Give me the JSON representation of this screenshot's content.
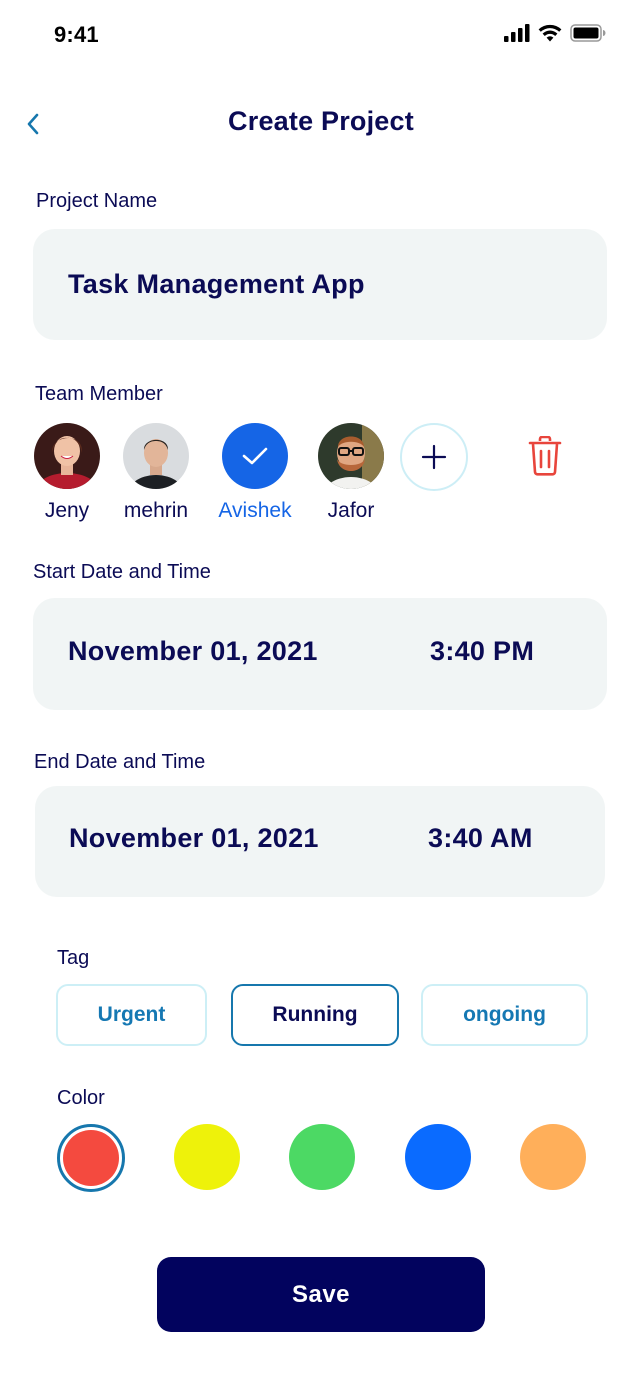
{
  "status_bar": {
    "time": "9:41"
  },
  "header": {
    "title": "Create Project"
  },
  "project_name": {
    "label": "Project Name",
    "value": "Task Management App"
  },
  "team": {
    "label": "Team Member",
    "members": [
      {
        "name": "Jeny",
        "selected": false
      },
      {
        "name": "mehrin",
        "selected": false
      },
      {
        "name": "Avishek",
        "selected": true
      },
      {
        "name": "Jafor",
        "selected": false
      }
    ]
  },
  "start": {
    "label": "Start Date and Time",
    "date": "November 01, 2021",
    "time": "3:40 PM"
  },
  "end": {
    "label": "End Date and Time",
    "date": "November 01, 2021",
    "time": "3:40 AM"
  },
  "tags": {
    "label": "Tag",
    "items": [
      {
        "label": "Urgent",
        "selected": false
      },
      {
        "label": "Running",
        "selected": true
      },
      {
        "label": "ongoing",
        "selected": false
      }
    ]
  },
  "colors": {
    "label": "Color",
    "swatches": [
      "#f44a3f",
      "#eef20a",
      "#4cd964",
      "#0a6bff",
      "#ffaf5a"
    ],
    "selected_index": 0
  },
  "save": {
    "label": "Save"
  },
  "theme": {
    "primary": "#02035e",
    "accent_blue": "#1565e6",
    "delete_red": "#e8453c",
    "field_bg": "#f1f5f5"
  }
}
